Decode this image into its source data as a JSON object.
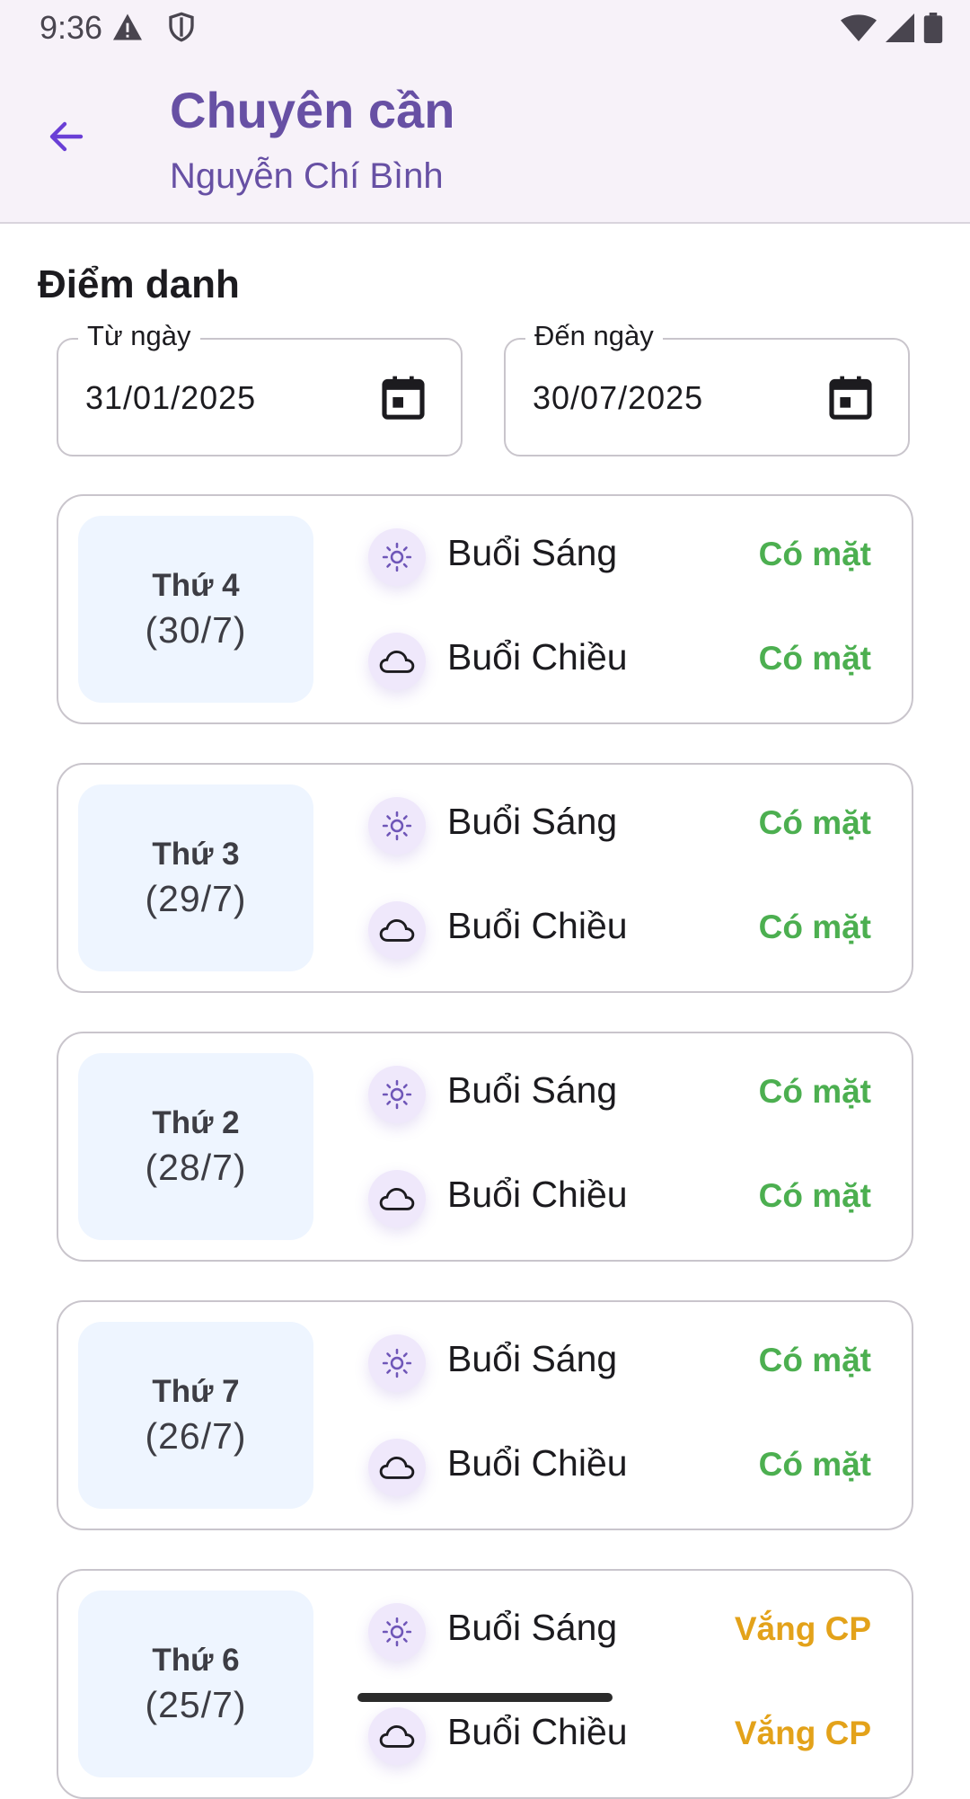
{
  "status_bar": {
    "time": "9:36"
  },
  "app_bar": {
    "title": "Chuyên cần",
    "subtitle": "Nguyễn Chí Bình"
  },
  "section": {
    "title": "Điểm danh"
  },
  "date_range": {
    "from": {
      "label": "Từ ngày",
      "value": "31/01/2025"
    },
    "to": {
      "label": "Đến ngày",
      "value": "30/07/2025"
    }
  },
  "colors": {
    "accent": "#6750a4",
    "present": "#4caf50",
    "absent": "#e3a21a",
    "day_bg": "#eef5ff"
  },
  "attendance": [
    {
      "day": "Thứ 4",
      "date": "(30/7)",
      "morning": {
        "label": "Buổi Sáng",
        "status": "Có mặt"
      },
      "afternoon": {
        "label": "Buổi Chiều",
        "status": "Có mặt"
      }
    },
    {
      "day": "Thứ 3",
      "date": "(29/7)",
      "morning": {
        "label": "Buổi Sáng",
        "status": "Có mặt"
      },
      "afternoon": {
        "label": "Buổi Chiều",
        "status": "Có mặt"
      }
    },
    {
      "day": "Thứ 2",
      "date": "(28/7)",
      "morning": {
        "label": "Buổi Sáng",
        "status": "Có mặt"
      },
      "afternoon": {
        "label": "Buổi Chiều",
        "status": "Có mặt"
      }
    },
    {
      "day": "Thứ 7",
      "date": "(26/7)",
      "morning": {
        "label": "Buổi Sáng",
        "status": "Có mặt"
      },
      "afternoon": {
        "label": "Buổi Chiều",
        "status": "Có mặt"
      }
    },
    {
      "day": "Thứ 6",
      "date": "(25/7)",
      "morning": {
        "label": "Buổi Sáng",
        "status": "Vắng CP"
      },
      "afternoon": {
        "label": "Buổi Chiều",
        "status": "Vắng CP"
      }
    }
  ]
}
